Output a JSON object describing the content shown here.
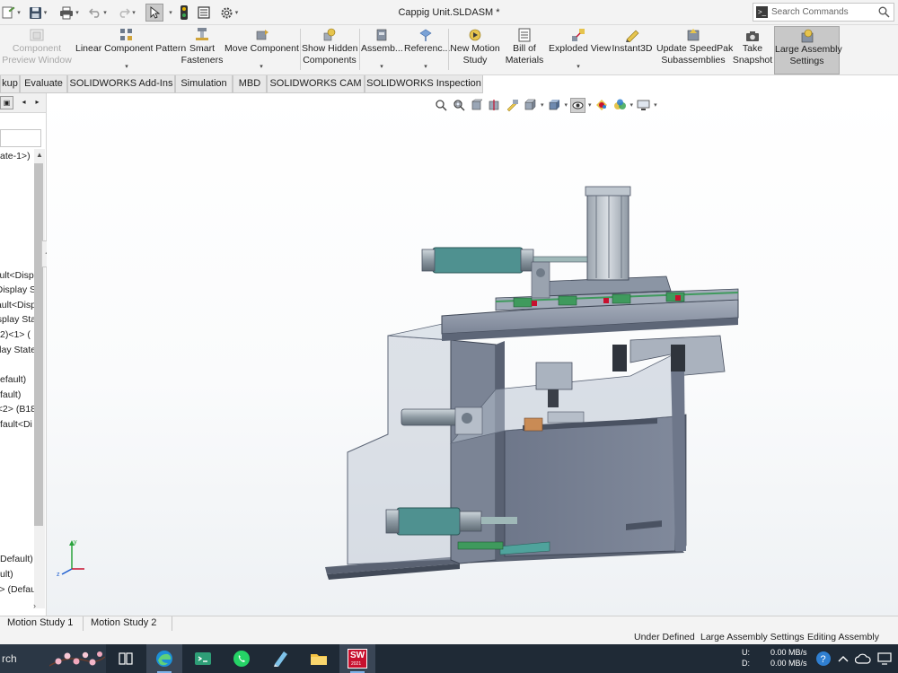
{
  "window": {
    "title": "Cappig Unit.SLDASM *"
  },
  "search": {
    "placeholder": "Search Commands"
  },
  "ribbon": {
    "buttons": [
      {
        "label": "Component Preview Window",
        "line1": "Component",
        "line2": "Preview Window",
        "enabled": false
      },
      {
        "label": "Linear Component Pattern",
        "line1": "Linear Component Pattern",
        "line2": ""
      },
      {
        "label": "Smart Fasteners",
        "line1": "Smart",
        "line2": "Fasteners"
      },
      {
        "label": "Move Component",
        "line1": "Move Component",
        "line2": ""
      },
      {
        "label": "Show Hidden Components",
        "line1": "Show Hidden",
        "line2": "Components"
      },
      {
        "label": "Assemb...",
        "line1": "Assemb...",
        "line2": ""
      },
      {
        "label": "Referenc...",
        "line1": "Referenc...",
        "line2": ""
      },
      {
        "label": "New Motion Study",
        "line1": "New Motion",
        "line2": "Study"
      },
      {
        "label": "Bill of Materials",
        "line1": "Bill of",
        "line2": "Materials"
      },
      {
        "label": "Exploded View",
        "line1": "Exploded View",
        "line2": ""
      },
      {
        "label": "Instant3D",
        "line1": "Instant3D",
        "line2": ""
      },
      {
        "label": "Update SpeedPak Subassemblies",
        "line1": "Update SpeedPak",
        "line2": "Subassemblies"
      },
      {
        "label": "Take Snapshot",
        "line1": "Take",
        "line2": "Snapshot"
      },
      {
        "label": "Large Assembly Settings",
        "line1": "Large Assembly",
        "line2": "Settings",
        "active": true
      }
    ]
  },
  "cm_tabs": [
    "kup",
    "Evaluate",
    "SOLIDWORKS Add-Ins",
    "Simulation",
    "MBD",
    "SOLIDWORKS CAM",
    "SOLIDWORKS Inspection"
  ],
  "feature_tree": {
    "items": [
      "ate-1>)",
      "ult<Displ",
      "Display S",
      "ault<Disp",
      "isplay Sta",
      "2)<1> (",
      "lay State",
      "efault)",
      "fault)",
      "<2> (B18",
      "fault<Di",
      "Default)",
      "ult)",
      "> (Defau"
    ]
  },
  "motion_tabs": [
    "Motion Study 1",
    "Motion Study 2"
  ],
  "status": {
    "state": "Under Defined",
    "mode": "Large Assembly Settings",
    "editing": "Editing Assembly"
  },
  "taskbar": {
    "search_text": "rch",
    "net_up_label": "U:",
    "net_down_label": "D:",
    "net_up": "0.00 MB/s",
    "net_down": "0.00 MB/s",
    "sw_badge": "SW",
    "sw_year": "2021"
  },
  "triad": {
    "x": "x",
    "y": "y",
    "z": "z"
  },
  "colors": {
    "ribbon_bg": "#f3f3f3",
    "taskbar_bg": "#1f2a36",
    "model_steel": "#8f98a8",
    "model_dark": "#5f6878",
    "rail_green": "#3f9a5d",
    "cylinder_teal": "#4f9190",
    "solidworks_red": "#c8102e"
  }
}
